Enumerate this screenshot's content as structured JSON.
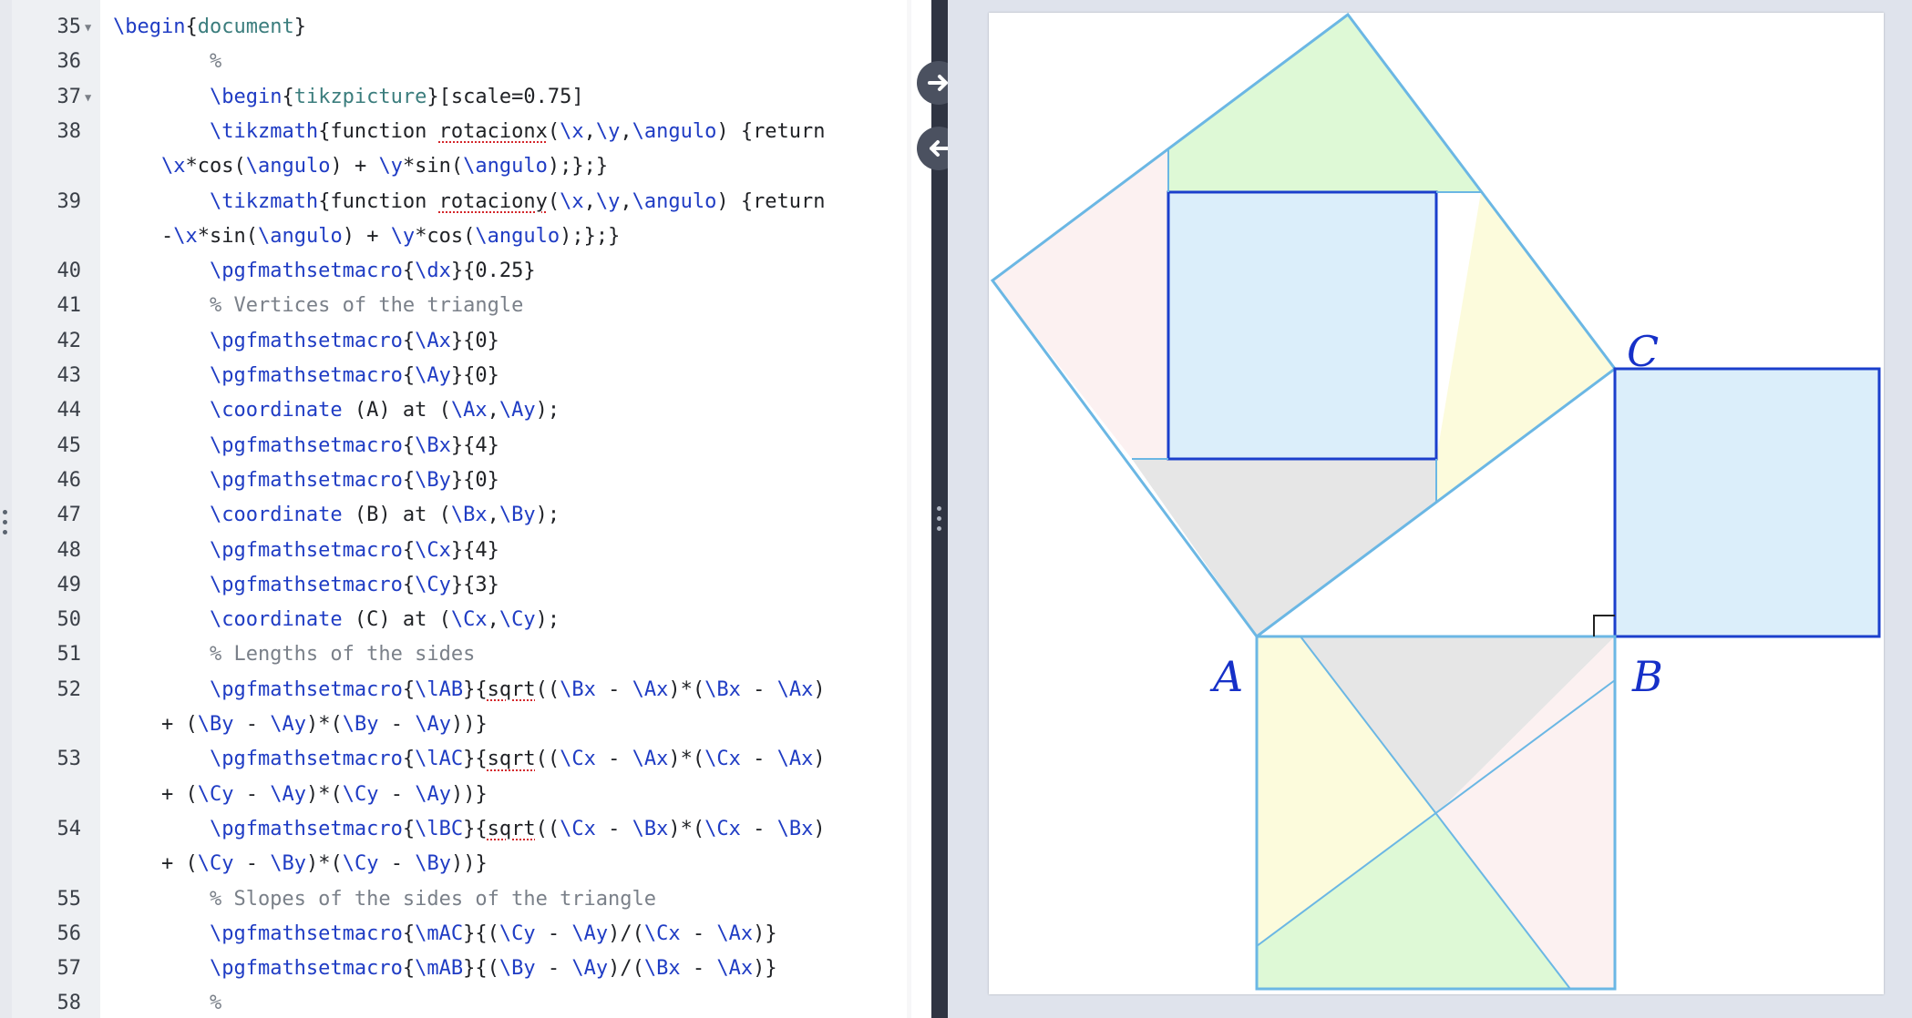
{
  "editor": {
    "lines": [
      {
        "num": "35",
        "fold": true,
        "segs": [
          [
            "k",
            "\\begin"
          ],
          [
            "",
            "{"
          ],
          [
            "a",
            "document"
          ],
          [
            "",
            "}"
          ]
        ]
      },
      {
        "num": "36",
        "segs": [
          [
            "c",
            "        %"
          ]
        ]
      },
      {
        "num": "37",
        "fold": true,
        "segs": [
          [
            "",
            "        "
          ],
          [
            "k",
            "\\begin"
          ],
          [
            "",
            "{"
          ],
          [
            "a",
            "tikzpicture"
          ],
          [
            "",
            "}[scale=0.75]"
          ]
        ]
      },
      {
        "num": "38",
        "segs": [
          [
            "",
            "        "
          ],
          [
            "k",
            "\\tikzmath"
          ],
          [
            "",
            "{function "
          ],
          [
            "s",
            "rotacionx"
          ],
          [
            "",
            "("
          ],
          [
            "k",
            "\\x"
          ],
          [
            "",
            ","
          ],
          [
            "k",
            "\\y"
          ],
          [
            "",
            ","
          ],
          [
            "k",
            "\\angulo"
          ],
          [
            "",
            ") {return"
          ]
        ]
      },
      {
        "num": "",
        "cont": true,
        "segs": [
          [
            "k",
            "\\x"
          ],
          [
            "",
            "*cos("
          ],
          [
            "k",
            "\\angulo"
          ],
          [
            "",
            ") + "
          ],
          [
            "k",
            "\\y"
          ],
          [
            "",
            "*sin("
          ],
          [
            "k",
            "\\angulo"
          ],
          [
            "",
            ");};}"
          ]
        ]
      },
      {
        "num": "39",
        "segs": [
          [
            "",
            "        "
          ],
          [
            "k",
            "\\tikzmath"
          ],
          [
            "",
            "{function "
          ],
          [
            "s",
            "rotaciony"
          ],
          [
            "",
            "("
          ],
          [
            "k",
            "\\x"
          ],
          [
            "",
            ","
          ],
          [
            "k",
            "\\y"
          ],
          [
            "",
            ","
          ],
          [
            "k",
            "\\angulo"
          ],
          [
            "",
            ") {return"
          ]
        ]
      },
      {
        "num": "",
        "cont": true,
        "segs": [
          [
            "",
            "-"
          ],
          [
            "k",
            "\\x"
          ],
          [
            "",
            "*sin("
          ],
          [
            "k",
            "\\angulo"
          ],
          [
            "",
            ") + "
          ],
          [
            "k",
            "\\y"
          ],
          [
            "",
            "*cos("
          ],
          [
            "k",
            "\\angulo"
          ],
          [
            "",
            ");};}"
          ]
        ]
      },
      {
        "num": "40",
        "segs": [
          [
            "",
            "        "
          ],
          [
            "k",
            "\\pgfmathsetmacro"
          ],
          [
            "",
            "{"
          ],
          [
            "k",
            "\\dx"
          ],
          [
            "",
            "}{0.25}"
          ]
        ]
      },
      {
        "num": "41",
        "segs": [
          [
            "c",
            "        % Vertices of the triangle"
          ]
        ]
      },
      {
        "num": "42",
        "segs": [
          [
            "",
            "        "
          ],
          [
            "k",
            "\\pgfmathsetmacro"
          ],
          [
            "",
            "{"
          ],
          [
            "k",
            "\\Ax"
          ],
          [
            "",
            "}{0}"
          ]
        ]
      },
      {
        "num": "43",
        "segs": [
          [
            "",
            "        "
          ],
          [
            "k",
            "\\pgfmathsetmacro"
          ],
          [
            "",
            "{"
          ],
          [
            "k",
            "\\Ay"
          ],
          [
            "",
            "}{0}"
          ]
        ]
      },
      {
        "num": "44",
        "segs": [
          [
            "",
            "        "
          ],
          [
            "k",
            "\\coordinate"
          ],
          [
            "",
            " (A) at ("
          ],
          [
            "k",
            "\\Ax"
          ],
          [
            "",
            ","
          ],
          [
            "k",
            "\\Ay"
          ],
          [
            "",
            ");"
          ]
        ]
      },
      {
        "num": "45",
        "segs": [
          [
            "",
            "        "
          ],
          [
            "k",
            "\\pgfmathsetmacro"
          ],
          [
            "",
            "{"
          ],
          [
            "k",
            "\\Bx"
          ],
          [
            "",
            "}{4}"
          ]
        ]
      },
      {
        "num": "46",
        "segs": [
          [
            "",
            "        "
          ],
          [
            "k",
            "\\pgfmathsetmacro"
          ],
          [
            "",
            "{"
          ],
          [
            "k",
            "\\By"
          ],
          [
            "",
            "}{0}"
          ]
        ]
      },
      {
        "num": "47",
        "segs": [
          [
            "",
            "        "
          ],
          [
            "k",
            "\\coordinate"
          ],
          [
            "",
            " (B) at ("
          ],
          [
            "k",
            "\\Bx"
          ],
          [
            "",
            ","
          ],
          [
            "k",
            "\\By"
          ],
          [
            "",
            ");"
          ]
        ]
      },
      {
        "num": "48",
        "segs": [
          [
            "",
            "        "
          ],
          [
            "k",
            "\\pgfmathsetmacro"
          ],
          [
            "",
            "{"
          ],
          [
            "k",
            "\\Cx"
          ],
          [
            "",
            "}{4}"
          ]
        ]
      },
      {
        "num": "49",
        "segs": [
          [
            "",
            "        "
          ],
          [
            "k",
            "\\pgfmathsetmacro"
          ],
          [
            "",
            "{"
          ],
          [
            "k",
            "\\Cy"
          ],
          [
            "",
            "}{3}"
          ]
        ]
      },
      {
        "num": "50",
        "segs": [
          [
            "",
            "        "
          ],
          [
            "k",
            "\\coordinate"
          ],
          [
            "",
            " (C) at ("
          ],
          [
            "k",
            "\\Cx"
          ],
          [
            "",
            ","
          ],
          [
            "k",
            "\\Cy"
          ],
          [
            "",
            ");"
          ]
        ]
      },
      {
        "num": "51",
        "segs": [
          [
            "c",
            "        % Lengths of the sides"
          ]
        ]
      },
      {
        "num": "52",
        "segs": [
          [
            "",
            "        "
          ],
          [
            "k",
            "\\pgfmathsetmacro"
          ],
          [
            "",
            "{"
          ],
          [
            "k",
            "\\lAB"
          ],
          [
            "",
            "}{"
          ],
          [
            "s",
            "sqrt"
          ],
          [
            "",
            "(("
          ],
          [
            "k",
            "\\Bx"
          ],
          [
            "",
            " - "
          ],
          [
            "k",
            "\\Ax"
          ],
          [
            "",
            ")*("
          ],
          [
            "k",
            "\\Bx"
          ],
          [
            "",
            " - "
          ],
          [
            "k",
            "\\Ax"
          ],
          [
            "",
            ")"
          ]
        ]
      },
      {
        "num": "",
        "cont": true,
        "segs": [
          [
            "",
            "+ ("
          ],
          [
            "k",
            "\\By"
          ],
          [
            "",
            " - "
          ],
          [
            "k",
            "\\Ay"
          ],
          [
            "",
            ")*("
          ],
          [
            "k",
            "\\By"
          ],
          [
            "",
            " - "
          ],
          [
            "k",
            "\\Ay"
          ],
          [
            "",
            "))}"
          ]
        ]
      },
      {
        "num": "53",
        "segs": [
          [
            "",
            "        "
          ],
          [
            "k",
            "\\pgfmathsetmacro"
          ],
          [
            "",
            "{"
          ],
          [
            "k",
            "\\lAC"
          ],
          [
            "",
            "}{"
          ],
          [
            "s",
            "sqrt"
          ],
          [
            "",
            "(("
          ],
          [
            "k",
            "\\Cx"
          ],
          [
            "",
            " - "
          ],
          [
            "k",
            "\\Ax"
          ],
          [
            "",
            ")*("
          ],
          [
            "k",
            "\\Cx"
          ],
          [
            "",
            " - "
          ],
          [
            "k",
            "\\Ax"
          ],
          [
            "",
            ")"
          ]
        ]
      },
      {
        "num": "",
        "cont": true,
        "segs": [
          [
            "",
            "+ ("
          ],
          [
            "k",
            "\\Cy"
          ],
          [
            "",
            " - "
          ],
          [
            "k",
            "\\Ay"
          ],
          [
            "",
            ")*("
          ],
          [
            "k",
            "\\Cy"
          ],
          [
            "",
            " - "
          ],
          [
            "k",
            "\\Ay"
          ],
          [
            "",
            "))}"
          ]
        ]
      },
      {
        "num": "54",
        "segs": [
          [
            "",
            "        "
          ],
          [
            "k",
            "\\pgfmathsetmacro"
          ],
          [
            "",
            "{"
          ],
          [
            "k",
            "\\lBC"
          ],
          [
            "",
            "}{"
          ],
          [
            "s",
            "sqrt"
          ],
          [
            "",
            "(("
          ],
          [
            "k",
            "\\Cx"
          ],
          [
            "",
            " - "
          ],
          [
            "k",
            "\\Bx"
          ],
          [
            "",
            ")*("
          ],
          [
            "k",
            "\\Cx"
          ],
          [
            "",
            " - "
          ],
          [
            "k",
            "\\Bx"
          ],
          [
            "",
            ")"
          ]
        ]
      },
      {
        "num": "",
        "cont": true,
        "segs": [
          [
            "",
            "+ ("
          ],
          [
            "k",
            "\\Cy"
          ],
          [
            "",
            " - "
          ],
          [
            "k",
            "\\By"
          ],
          [
            "",
            ")*("
          ],
          [
            "k",
            "\\Cy"
          ],
          [
            "",
            " - "
          ],
          [
            "k",
            "\\By"
          ],
          [
            "",
            "))}"
          ]
        ]
      },
      {
        "num": "55",
        "segs": [
          [
            "c",
            "        % Slopes of the sides of the triangle"
          ]
        ]
      },
      {
        "num": "56",
        "segs": [
          [
            "",
            "        "
          ],
          [
            "k",
            "\\pgfmathsetmacro"
          ],
          [
            "",
            "{"
          ],
          [
            "k",
            "\\mAC"
          ],
          [
            "",
            "}{("
          ],
          [
            "k",
            "\\Cy"
          ],
          [
            "",
            " - "
          ],
          [
            "k",
            "\\Ay"
          ],
          [
            "",
            ")/("
          ],
          [
            "k",
            "\\Cx"
          ],
          [
            "",
            " - "
          ],
          [
            "k",
            "\\Ax"
          ],
          [
            "",
            ")}"
          ]
        ]
      },
      {
        "num": "57",
        "segs": [
          [
            "",
            "        "
          ],
          [
            "k",
            "\\pgfmathsetmacro"
          ],
          [
            "",
            "{"
          ],
          [
            "k",
            "\\mAB"
          ],
          [
            "",
            "}{("
          ],
          [
            "k",
            "\\By"
          ],
          [
            "",
            " - "
          ],
          [
            "k",
            "\\Ay"
          ],
          [
            "",
            ")/("
          ],
          [
            "k",
            "\\Bx"
          ],
          [
            "",
            " - "
          ],
          [
            "k",
            "\\Ax"
          ],
          [
            "",
            ")}"
          ]
        ]
      },
      {
        "num": "58",
        "segs": [
          [
            "c",
            "        %"
          ]
        ]
      }
    ]
  },
  "splitter": {
    "forward_icon": "arrow-right-icon",
    "back_icon": "arrow-left-icon"
  },
  "preview": {
    "labels": {
      "a": "A",
      "b": "B",
      "c": "C"
    },
    "colors": {
      "edge": "#6bb7e4",
      "inner_square": "#1b3fcc",
      "light_blue": "#dbeefa",
      "green": "#def9d6",
      "yellow": "#fcfbdc",
      "pink": "#fcf1f1",
      "gray": "#e6e6e6",
      "label": "#1630c8"
    }
  }
}
